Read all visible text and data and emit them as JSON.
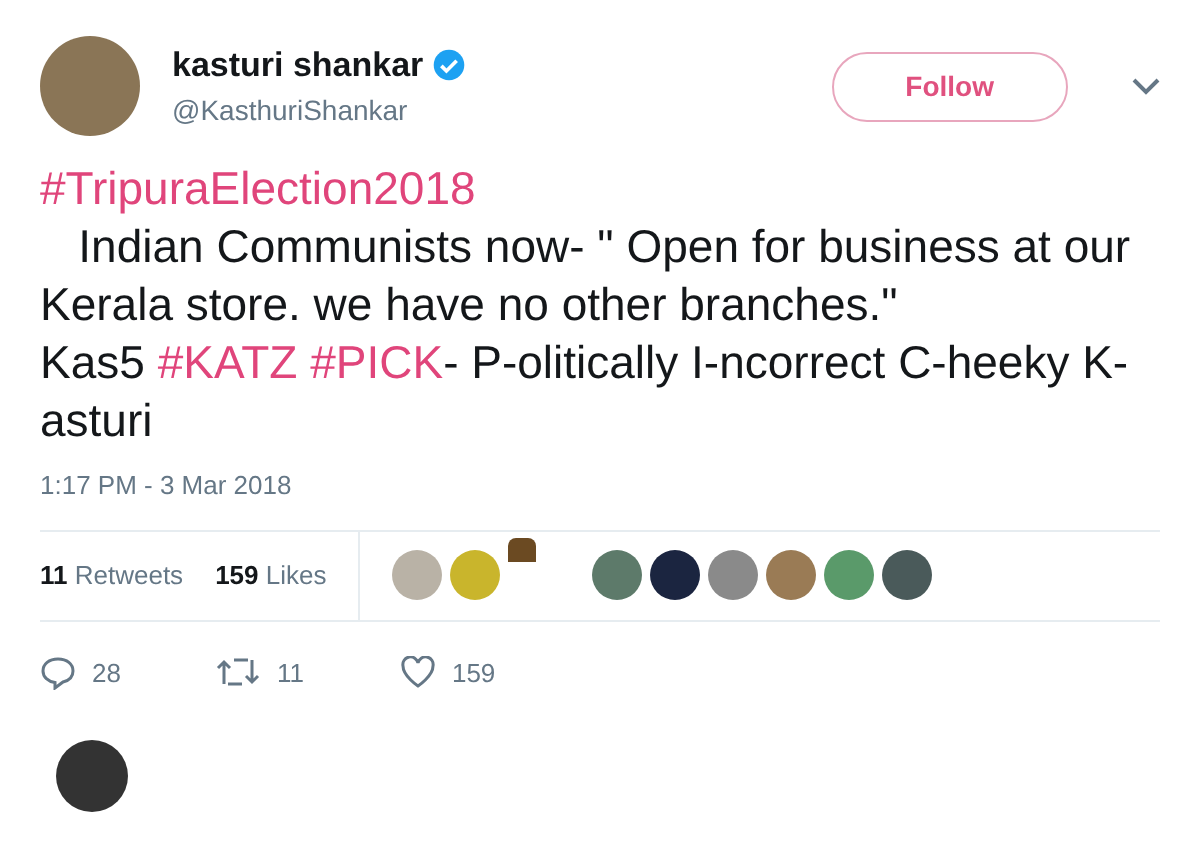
{
  "author": {
    "name": "kasturi shankar",
    "handle": "@KasthuriShankar",
    "verified": true
  },
  "follow_button": {
    "label": "Follow"
  },
  "tweet": {
    "paragraphs": [
      [
        {
          "kind": "hashtag",
          "text": "#TripuraElection2018"
        }
      ],
      [
        {
          "kind": "text",
          "text": "   Indian Communists now- \" Open for business at our Kerala store. we have no other branches.\""
        }
      ],
      [
        {
          "kind": "text",
          "text": "Kas5 "
        },
        {
          "kind": "hashtag",
          "text": "#KATZ"
        },
        {
          "kind": "hashtag",
          "text": "#PICK"
        },
        {
          "kind": "text",
          "text": "- P-olitically I-ncorrect C-heeky K-asturi"
        }
      ]
    ]
  },
  "timestamp": "1:17 PM - 3 Mar 2018",
  "stats": [
    {
      "count": "11",
      "label": "Retweets"
    },
    {
      "count": "159",
      "label": "Likes"
    }
  ],
  "actions": [
    {
      "kind": "reply",
      "count": "28"
    },
    {
      "kind": "retweet",
      "count": "11"
    },
    {
      "kind": "like",
      "count": "159"
    }
  ]
}
